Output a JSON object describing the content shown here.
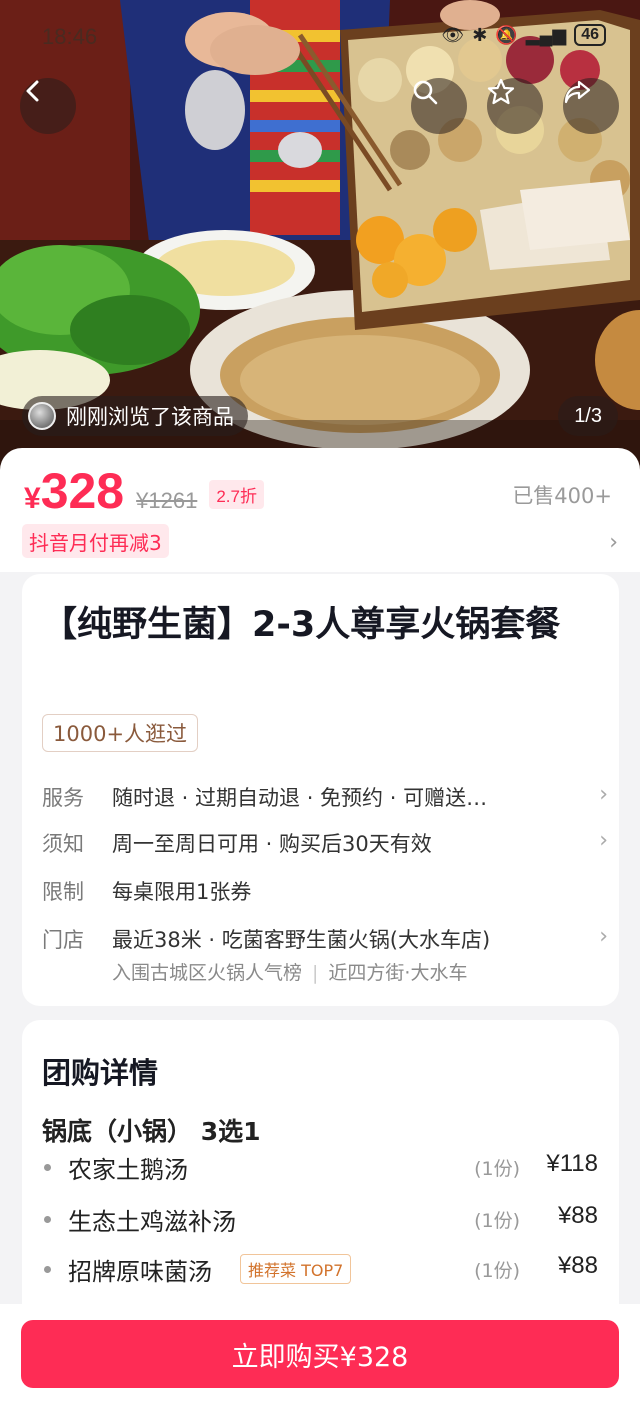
{
  "status_bar": {
    "time": "18:46",
    "battery": "46"
  },
  "hero": {
    "browse_text": "刚刚浏览了该商品",
    "page_indicator": "1/3"
  },
  "price": {
    "currency": "¥",
    "value": "328",
    "original": "¥1261",
    "discount": "2.7折",
    "sold": "已售400+",
    "promo": "抖音月付再减3"
  },
  "product": {
    "title": "【纯野生菌】2-3人尊享火锅套餐",
    "visit_badge": "1000+人逛过"
  },
  "info_rows": {
    "service": {
      "label": "服务",
      "text": "随时退 · 过期自动退 · 免预约 · 可赠送…"
    },
    "notice": {
      "label": "须知",
      "text": "周一至周日可用 · 购买后30天有效"
    },
    "limit": {
      "label": "限制",
      "text": "每桌限用1张券"
    },
    "store": {
      "label": "门店",
      "text": "最近38米 · 吃菌客野生菌火锅(大水车店)",
      "sub_left": "入围古城区火锅人气榜",
      "sub_right": "近四方街·大水车"
    }
  },
  "details": {
    "title": "团购详情",
    "group_title": "锅底（小锅） 3选1",
    "items": [
      {
        "name": "农家土鹅汤",
        "qty": "(1份)",
        "price": "¥118",
        "tag": ""
      },
      {
        "name": "生态土鸡滋补汤",
        "qty": "(1份)",
        "price": "¥88",
        "tag": ""
      },
      {
        "name": "招牌原味菌汤",
        "qty": "(1份)",
        "price": "¥88",
        "tag": "推荐菜 TOP7"
      }
    ]
  },
  "buy_button": "立即购买¥328",
  "icons": {
    "back": "chevron-left-icon",
    "search": "search-icon",
    "favorite": "star-icon",
    "share": "share-icon",
    "chevron": "chevron-right-icon"
  },
  "colors": {
    "accent": "#fe2c55",
    "accent_bg": "#ffe8ec",
    "tag_brown": "#8a5a3c"
  }
}
